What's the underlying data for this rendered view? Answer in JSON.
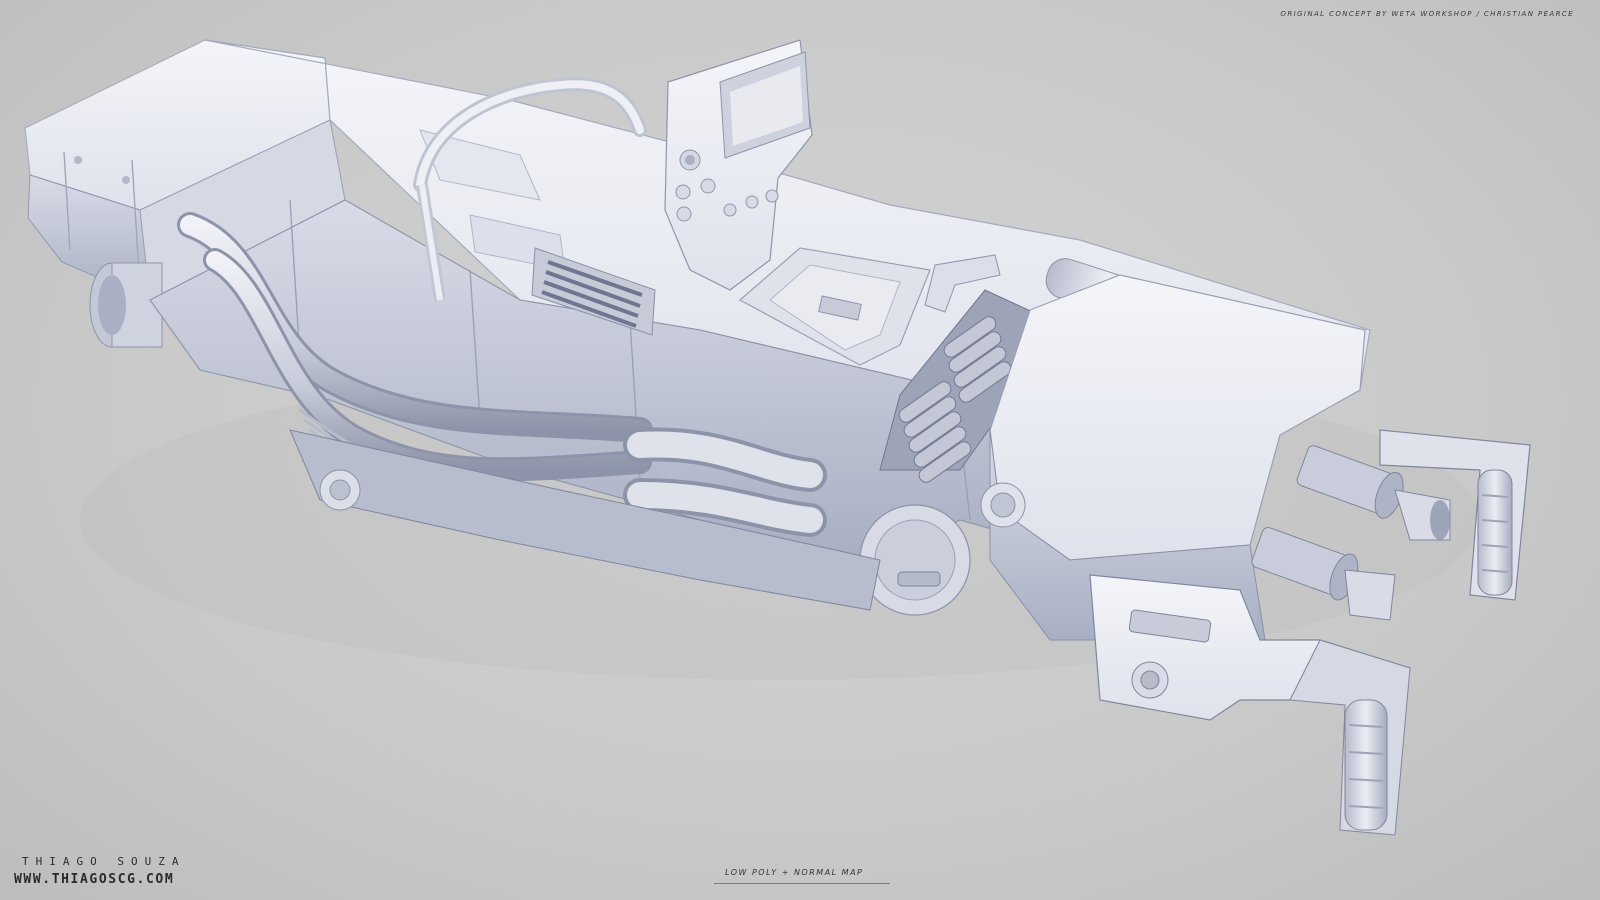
{
  "credit_text": "ORIGINAL CONCEPT BY WETA WORKSHOP / CHRISTIAN PEARCE",
  "author_name": "THIAGO SOUZA",
  "author_site": "WWW.THIAGOSCG.COM",
  "caption": "LOW POLY + NORMAL MAP",
  "subject": "weapon-model-render",
  "colors": {
    "background": "#c9c9c9",
    "model_light": "#eef0f6",
    "model_mid": "#d3d7e3",
    "model_shadow": "#9ea4b8",
    "model_dark": "#6c7389"
  }
}
